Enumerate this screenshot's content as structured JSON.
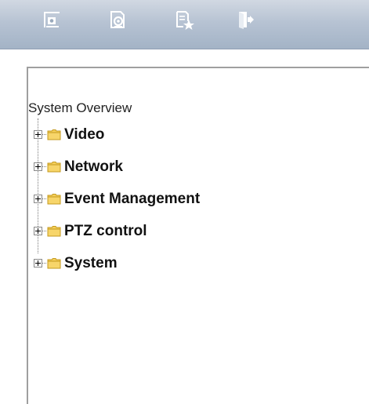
{
  "toolbar": {
    "buttons": [
      {
        "icon": "camera-view-icon",
        "label": ""
      },
      {
        "icon": "settings-icon",
        "label": ""
      },
      {
        "icon": "favorites-icon",
        "label": ""
      },
      {
        "icon": "logout-icon",
        "label": ""
      }
    ],
    "background_color": "#b9c5d5",
    "icon_color": "#ffffff"
  },
  "tree": {
    "root_label": "System Overview",
    "items": [
      {
        "label": "Video",
        "icon": "folder-icon",
        "expanded": false
      },
      {
        "label": "Network",
        "icon": "folder-icon",
        "expanded": false
      },
      {
        "label": "Event Management",
        "icon": "folder-icon",
        "expanded": false
      },
      {
        "label": "PTZ control",
        "icon": "folder-icon",
        "expanded": false
      },
      {
        "label": "System",
        "icon": "folder-icon",
        "expanded": false
      }
    ],
    "folder_color": "#f2c94c"
  }
}
